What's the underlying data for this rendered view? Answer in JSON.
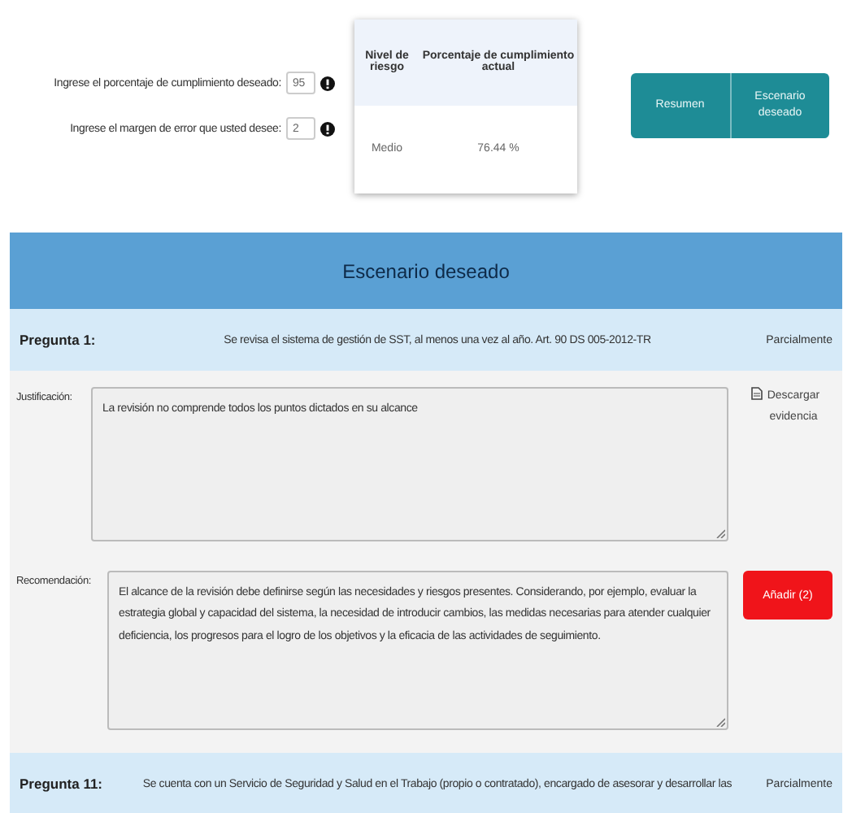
{
  "inputs": [
    {
      "label": "Ingrese el porcentaje de cumplimiento deseado:",
      "value": "95"
    },
    {
      "label": "Ingrese el margen de error que usted desee:",
      "value": "2"
    }
  ],
  "risk_table": {
    "columns": [
      "Nivel de riesgo",
      "Porcentaje de cumplimiento actual"
    ],
    "rows": [
      [
        "Medio",
        "76.44 %"
      ]
    ]
  },
  "buttons": [
    "Resumen",
    "Escenario deseado"
  ],
  "section": {
    "title": "Escenario deseado"
  },
  "questions": [
    {
      "label": "Pregunta 1:",
      "text": "Se revisa el sistema de gestión de SST, al menos una vez al año. Art. 90 DS 005-2012-TR",
      "answer": "Parcialmente",
      "justification_label": "Justificación:",
      "justification": "La revisión no comprende todos los puntos dictados en su alcance",
      "download": "Descargar evidencia",
      "recommendation_label": "Recomendación:",
      "recommendation": "El alcance de la revisión debe definirse según las necesidades y riesgos presentes. Considerando, por ejemplo, evaluar la estrategia global y capacidad del sistema, la necesidad de introducir cambios, las medidas necesarias para atender cualquier deficiencia, los progresos para el logro de los objetivos y la eficacia de las actividades de seguimiento.",
      "add_button": "Añadir (2)"
    },
    {
      "label": "Pregunta 11:",
      "text": "Se cuenta con un Servicio de Seguridad y Salud en el Trabajo (propio o contratado), encargado de asesorar y desarrollar las",
      "answer": "Parcialmente"
    }
  ]
}
